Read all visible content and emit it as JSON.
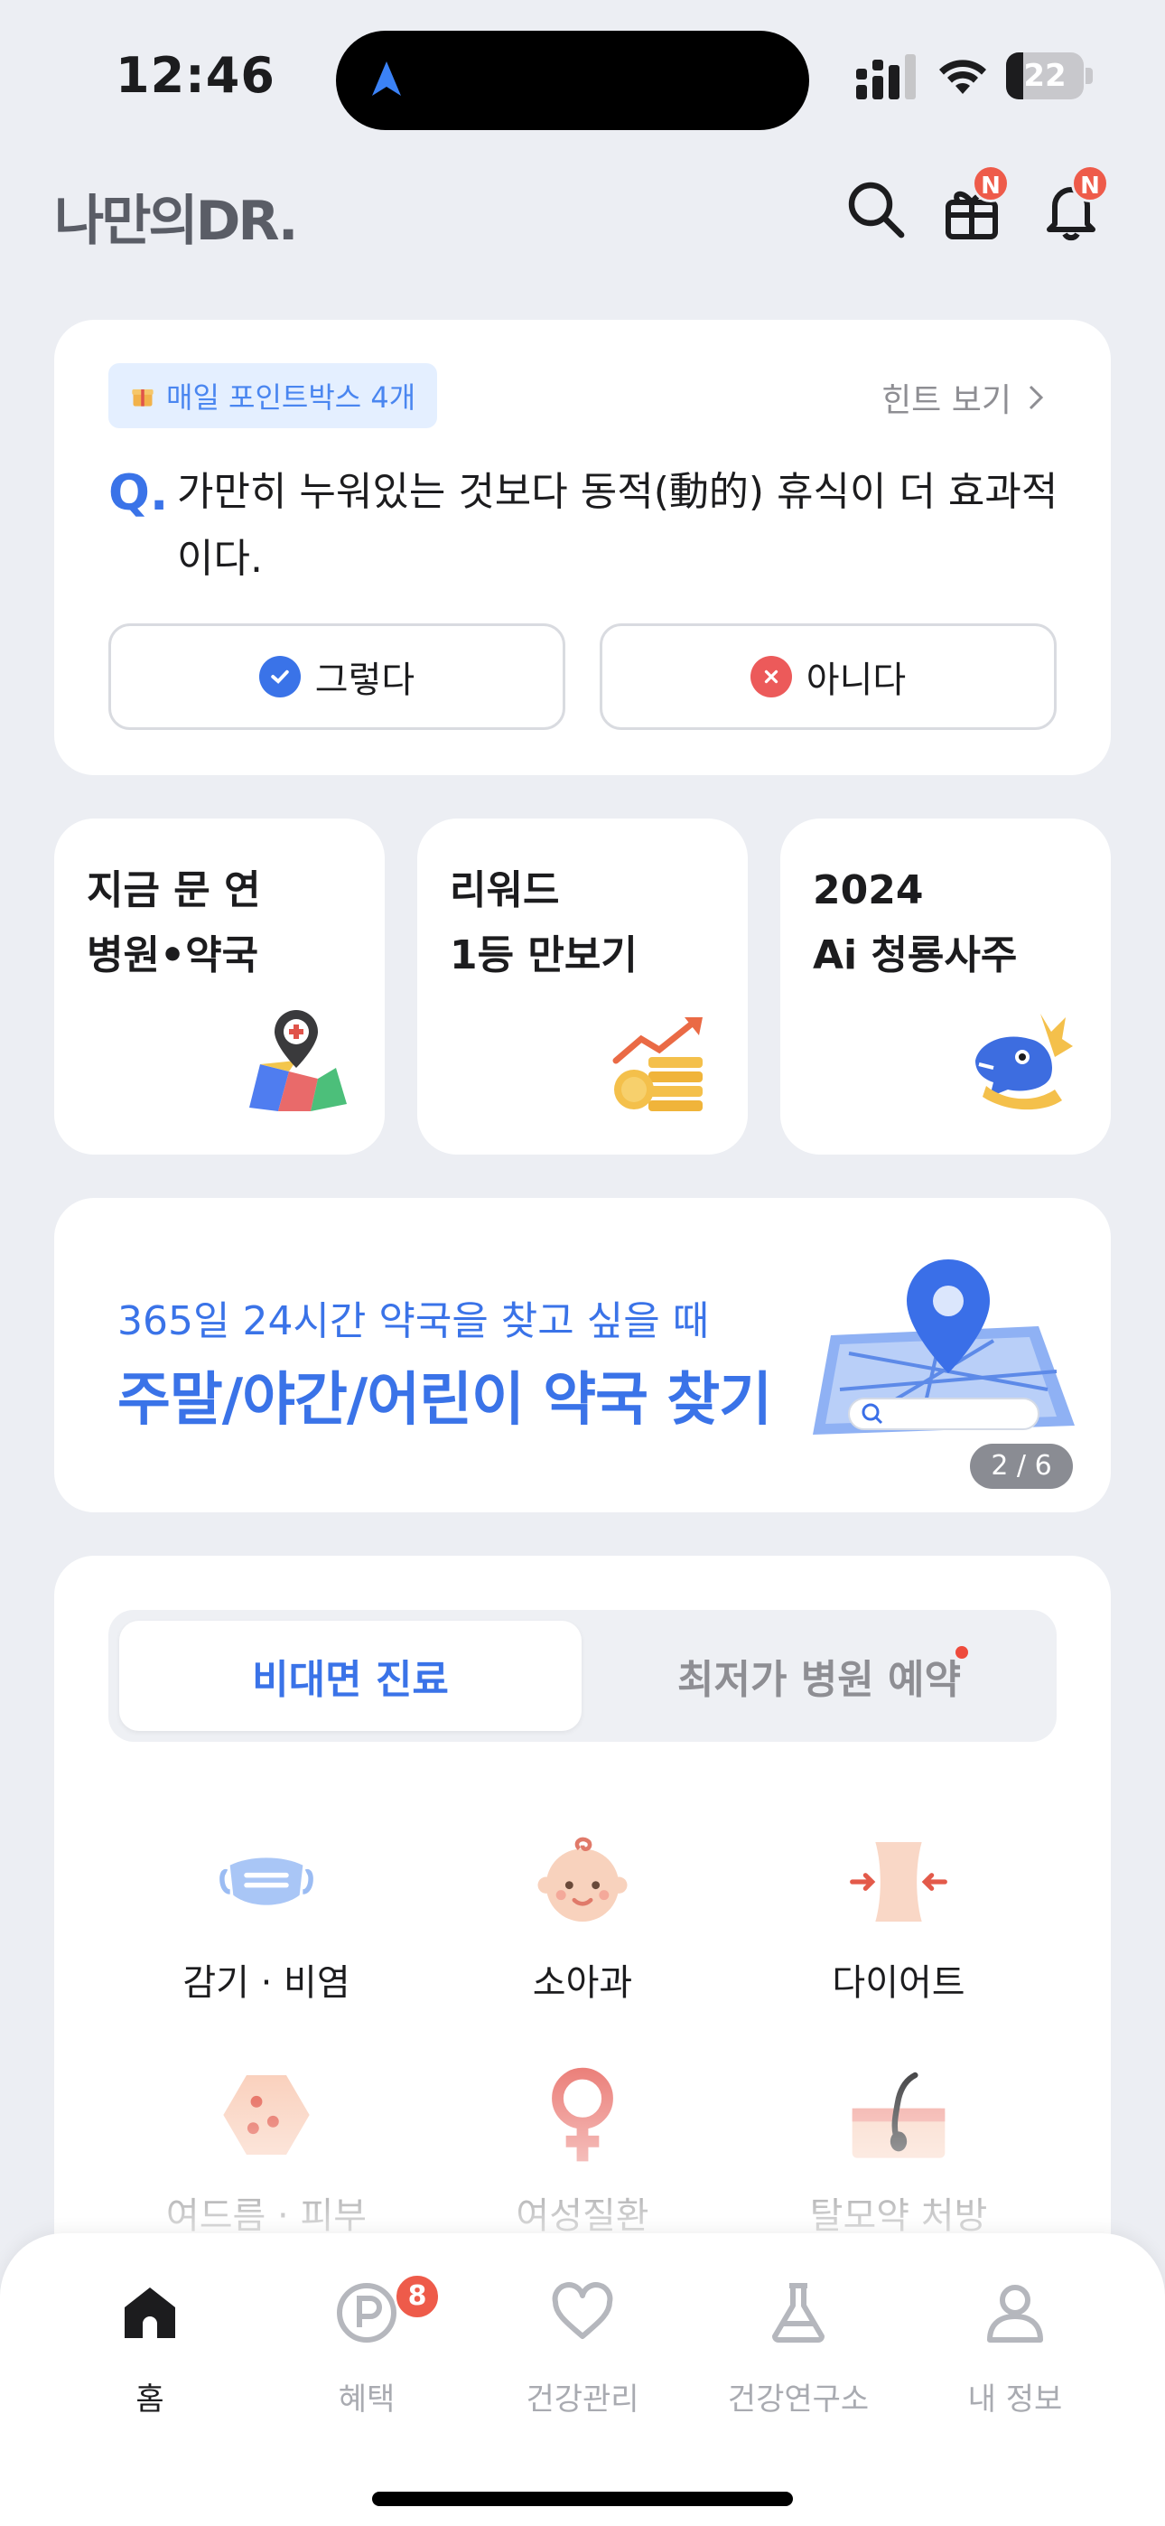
{
  "status_bar": {
    "time": "12:46",
    "battery": "22",
    "battery_level": 0.22
  },
  "header": {
    "logo": "나만의DR.",
    "gift_badge": "N",
    "bell_badge": "N"
  },
  "quiz": {
    "point_chip": "매일 포인트박스 4개",
    "hint": "힌트 보기",
    "q_mark": "Q.",
    "question": "가만히 누워있는 것보다 동적(動的) 휴식이 더 효과적이다.",
    "yes": "그렇다",
    "no": "아니다"
  },
  "tiles": [
    {
      "line1": "지금 문 연",
      "line2": "병원•약국"
    },
    {
      "line1": "리워드",
      "line2": "1등 만보기"
    },
    {
      "line1": "2024",
      "line2": "Ai 청룡사주"
    }
  ],
  "banner": {
    "subtitle": "365일 24시간 약국을 찾고 싶을 때",
    "title": "주말/야간/어린이 약국 찾기",
    "pager": "2 / 6"
  },
  "service": {
    "tab_active": "비대면 진료",
    "tab_inactive": "최저가 병원 예약",
    "categories": [
      {
        "label": "감기 · 비염"
      },
      {
        "label": "소아과"
      },
      {
        "label": "다이어트"
      },
      {
        "label": "여드름 · 피부"
      },
      {
        "label": "여성질환"
      },
      {
        "label": "탈모약 처방"
      }
    ]
  },
  "tabbar": {
    "items": [
      {
        "label": "홈"
      },
      {
        "label": "혜택",
        "badge": "8"
      },
      {
        "label": "건강관리"
      },
      {
        "label": "건강연구소"
      },
      {
        "label": "내 정보"
      }
    ]
  },
  "colors": {
    "accent": "#3a73e8",
    "badge": "#ee5b4a",
    "background": "#eceef3"
  }
}
